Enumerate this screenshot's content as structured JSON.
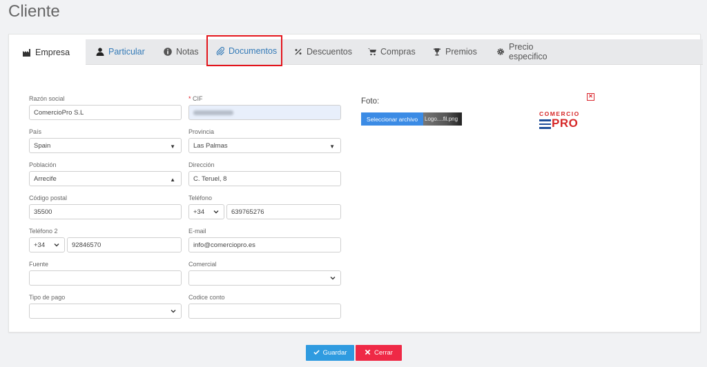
{
  "page_title": "Cliente",
  "tabs": [
    {
      "label": "Empresa",
      "icon": "factory-icon"
    },
    {
      "label": "Particular",
      "icon": "user-icon"
    },
    {
      "label": "Notas",
      "icon": "info-icon"
    },
    {
      "label": "Documentos",
      "icon": "paperclip-icon"
    },
    {
      "label": "Descuentos",
      "icon": "percent-icon"
    },
    {
      "label": "Compras",
      "icon": "cart-icon"
    },
    {
      "label": "Premios",
      "icon": "trophy-icon"
    },
    {
      "label": "Precio especifico",
      "icon": "gear-icon"
    }
  ],
  "form": {
    "razon_social": {
      "label": "Razón social",
      "value": "ComercioPro S.L"
    },
    "cif": {
      "label": "CIF",
      "required_mark": "*"
    },
    "pais": {
      "label": "País",
      "value": "Spain"
    },
    "provincia": {
      "label": "Provincia",
      "value": "Las Palmas"
    },
    "poblacion": {
      "label": "Población",
      "value": "Arrecife"
    },
    "direccion": {
      "label": "Dirección",
      "value": "C. Teruel, 8"
    },
    "codigo_postal": {
      "label": "Código postal",
      "value": "35500"
    },
    "telefono": {
      "label": "Teléfono",
      "prefix": "+34",
      "value": "639765276"
    },
    "telefono2": {
      "label": "Teléfono 2",
      "prefix": "+34",
      "value": "92846570"
    },
    "email": {
      "label": "E-mail",
      "value": "info@comerciopro.es"
    },
    "fuente": {
      "label": "Fuente",
      "value": ""
    },
    "comercial": {
      "label": "Comercial",
      "value": ""
    },
    "tipo_pago": {
      "label": "Tipo de pago",
      "value": ""
    },
    "codice_conto": {
      "label": "Codice conto",
      "value": ""
    }
  },
  "foto": {
    "label": "Foto:",
    "file_button": "Seleccionar archivo",
    "file_name": "Logo....fil.png",
    "remove_symbol": "✕",
    "logo_top": "COMERCIO",
    "logo_bottom": "PRO"
  },
  "buttons": {
    "save": "Guardar",
    "close": "Cerrar"
  },
  "colors": {
    "save": "#2f9be0",
    "close": "#ef2946",
    "highlight": "#e3141b",
    "link_blue": "#337ab7"
  }
}
